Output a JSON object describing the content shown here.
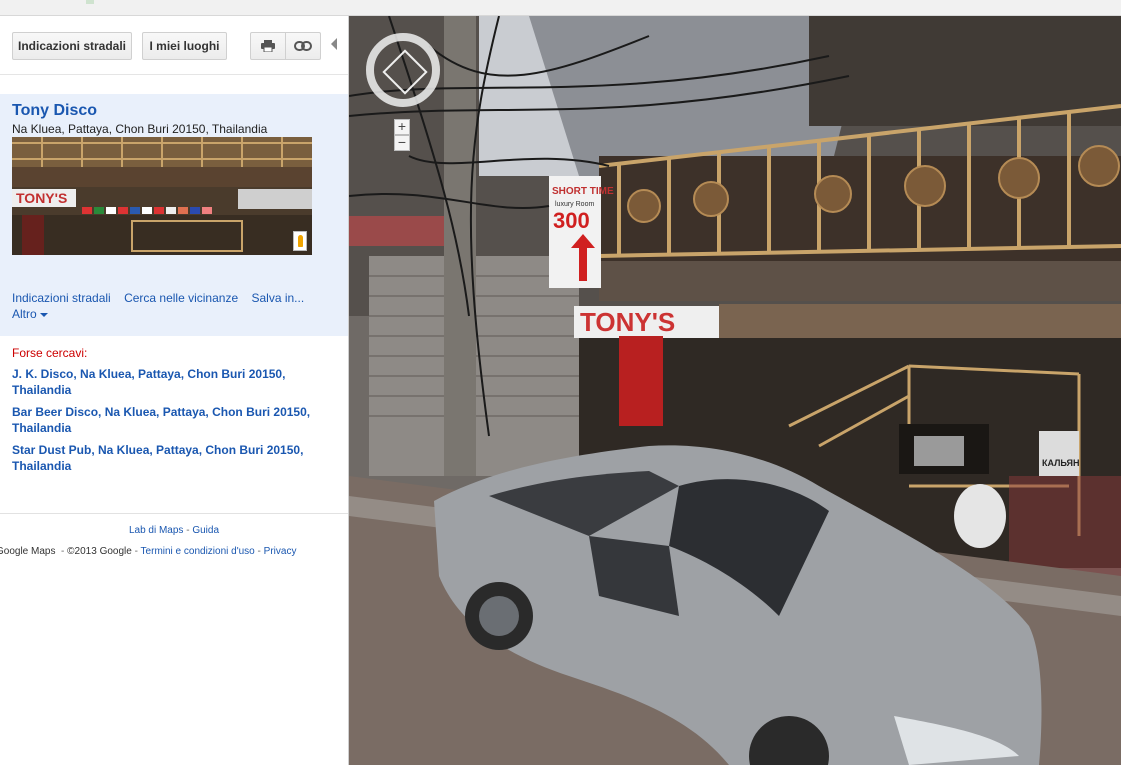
{
  "toolbar": {
    "directions_label": "Indicazioni stradali",
    "my_places_label": "I miei luoghi",
    "print_icon": "printer-icon",
    "link_icon": "link-icon"
  },
  "place": {
    "title": "Tony Disco",
    "address": "Na Kluea, Pattaya, Chon Buri 20150, Thailandia",
    "thumb_sign": "TONY'S"
  },
  "actions": {
    "directions": "Indicazioni stradali",
    "nearby": "Cerca nelle vicinanze",
    "save": "Salva in...",
    "more": "Altro"
  },
  "suggestions": {
    "label": "Forse cercavi:",
    "items": [
      "J. K. Disco, Na Kluea, Pattaya, Chon Buri 20150, Thailandia",
      "Bar Beer Disco, Na Kluea, Pattaya, Chon Buri 20150, Thailandia",
      "Star Dust Pub, Na Kluea, Pattaya, Chon Buri 20150, Thailandia"
    ]
  },
  "footer": {
    "labs": "Lab di Maps",
    "help": "Guida",
    "brand": "Google Maps",
    "copyright": "©2013 Google",
    "terms": "Termini e condizioni d'uso",
    "privacy": "Privacy",
    "sep": "-"
  },
  "streetview": {
    "sign_main": "TONY'S",
    "sign_short": "SHORT TIME",
    "sign_short_sub": "luxury Room",
    "sign_price": "300",
    "sign_kalyan": "КАЛЬЯН",
    "zoom_in": "+",
    "zoom_out": "−"
  },
  "colors": {
    "link": "#1a57b0",
    "result_bg": "#e9f0fb",
    "hint_red": "#cc0000"
  }
}
